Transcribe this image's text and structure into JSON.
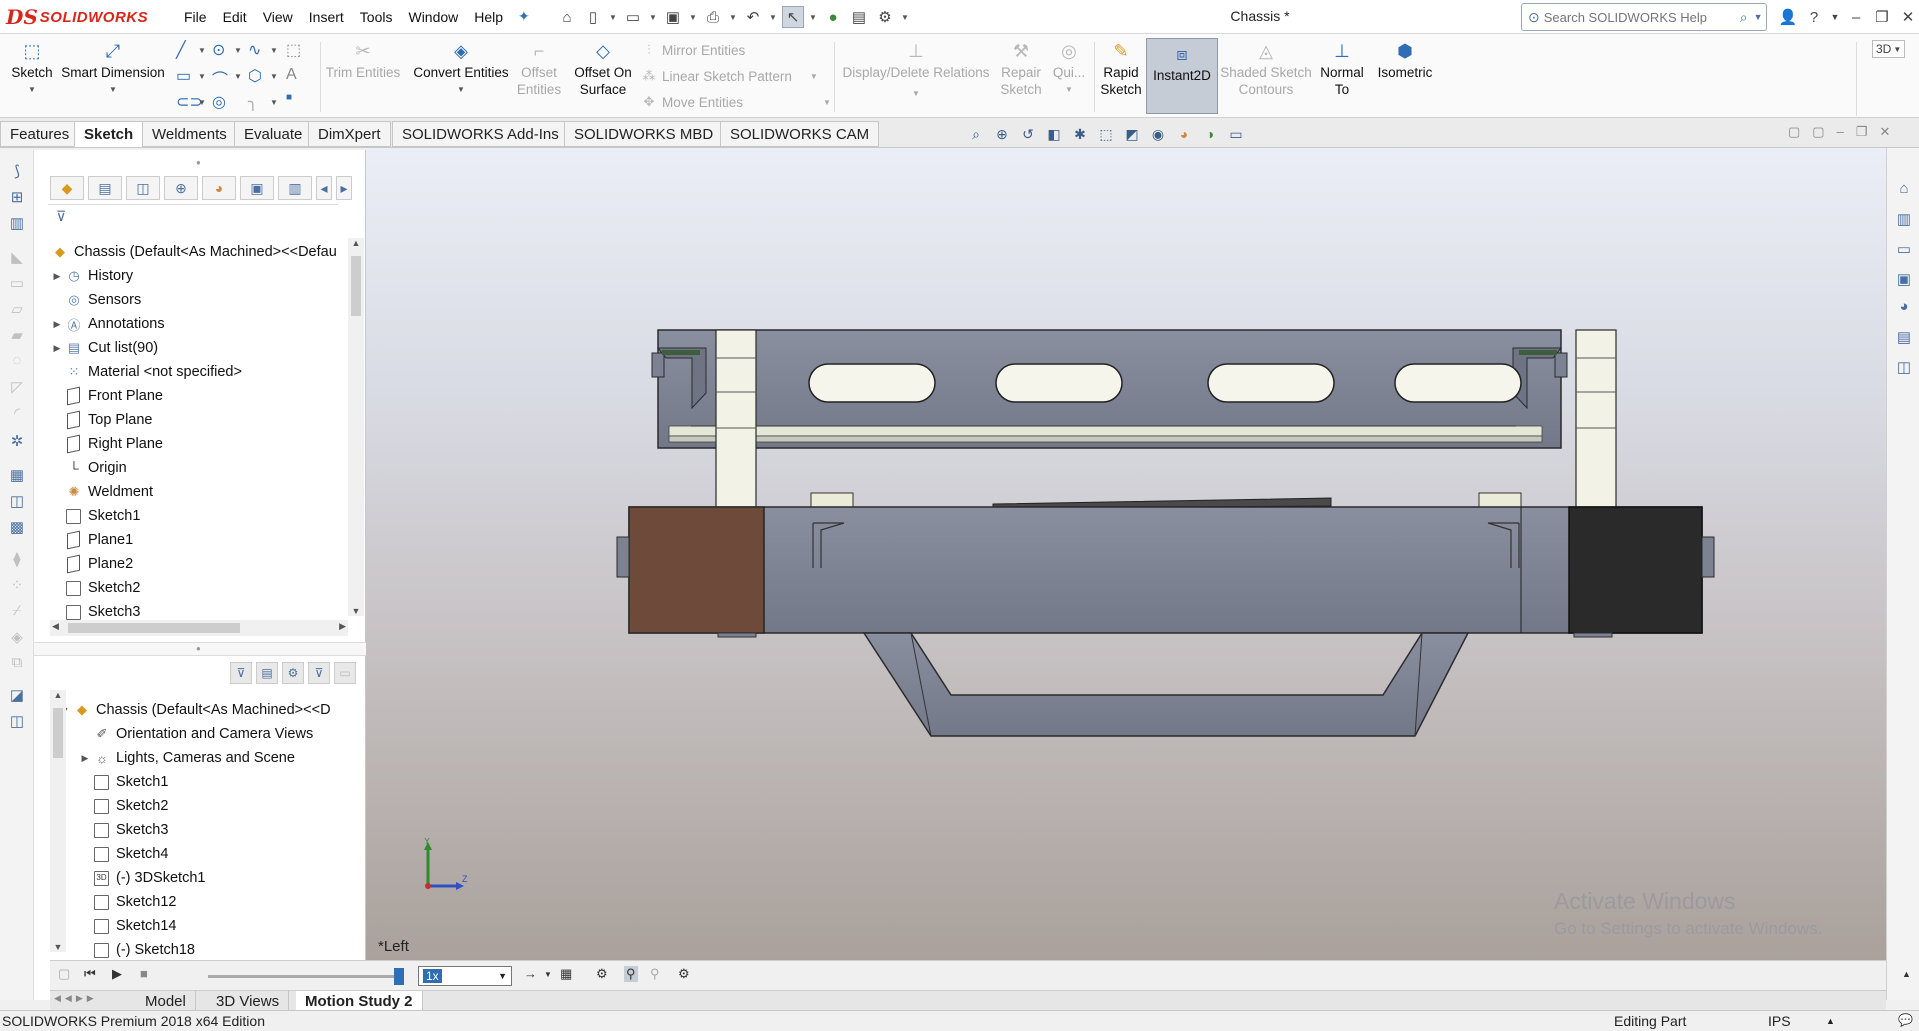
{
  "app": {
    "brand_mark": "DS",
    "brand_name": "SOLIDWORKS",
    "doc_title": "Chassis *"
  },
  "menu": [
    "File",
    "Edit",
    "View",
    "Insert",
    "Tools",
    "Window",
    "Help"
  ],
  "search": {
    "placeholder": "Search SOLIDWORKS Help"
  },
  "ribbon": {
    "sketch": "Sketch",
    "smart_dimension": "Smart Dimension",
    "trim_entities": "Trim Entities",
    "convert_entities": "Convert Entities",
    "offset_entities_1": "Offset",
    "offset_entities_2": "Entities",
    "offset_on_surface_1": "Offset On",
    "offset_on_surface_2": "Surface",
    "mirror_entities": "Mirror Entities",
    "linear_sketch_pattern": "Linear Sketch Pattern",
    "move_entities": "Move Entities",
    "display_delete_relations": "Display/Delete Relations",
    "repair_sketch_1": "Repair",
    "repair_sketch_2": "Sketch",
    "quick_snaps": "Qui...",
    "rapid_sketch_1": "Rapid",
    "rapid_sketch_2": "Sketch",
    "instant2d": "Instant2D",
    "shaded_contours_1": "Shaded Sketch",
    "shaded_contours_2": "Contours",
    "normal_to_1": "Normal",
    "normal_to_2": "To",
    "isometric": "Isometric"
  },
  "tabs": [
    "Features",
    "Sketch",
    "Weldments",
    "Evaluate",
    "DimXpert",
    "SOLIDWORKS Add-Ins",
    "SOLIDWORKS MBD",
    "SOLIDWORKS CAM"
  ],
  "active_tab": "Sketch",
  "feature_tree": {
    "root": "Chassis  (Default<As Machined><<Defau",
    "items": [
      "History",
      "Sensors",
      "Annotations",
      "Cut list(90)",
      "Material <not specified>",
      "Front Plane",
      "Top Plane",
      "Right Plane",
      "Origin",
      "Weldment",
      "Sketch1",
      "Plane1",
      "Plane2",
      "Sketch2",
      "Sketch3"
    ]
  },
  "display_tree": {
    "root": "Chassis  (Default<As Machined><<D",
    "items": [
      "Orientation and Camera Views",
      "Lights, Cameras and Scene",
      "Sketch1",
      "Sketch2",
      "Sketch3",
      "Sketch4",
      "(-) 3DSketch1",
      "Sketch12",
      "Sketch14",
      "(-) Sketch18"
    ],
    "sketch3d_badge": "3D"
  },
  "viewport": {
    "view_label": "*Left",
    "triad_y": "Y",
    "triad_z": "Z",
    "watermark_1": "Activate Windows",
    "watermark_2": "Go to Settings to activate Windows.",
    "view3d": "3D"
  },
  "motion": {
    "speed": "1x"
  },
  "bottom_tabs": [
    "Model",
    "3D Views",
    "Motion Study 2"
  ],
  "active_bottom_tab": "Motion Study 2",
  "status": {
    "edition": "SOLIDWORKS Premium 2018 x64 Edition",
    "mode": "Editing Part",
    "units": "IPS"
  },
  "colors": {
    "accent": "#2f6db5",
    "brand": "#d9261c",
    "steel": "#7f8495",
    "wood": "#6e4a3a",
    "dark": "#2a2a2a"
  }
}
